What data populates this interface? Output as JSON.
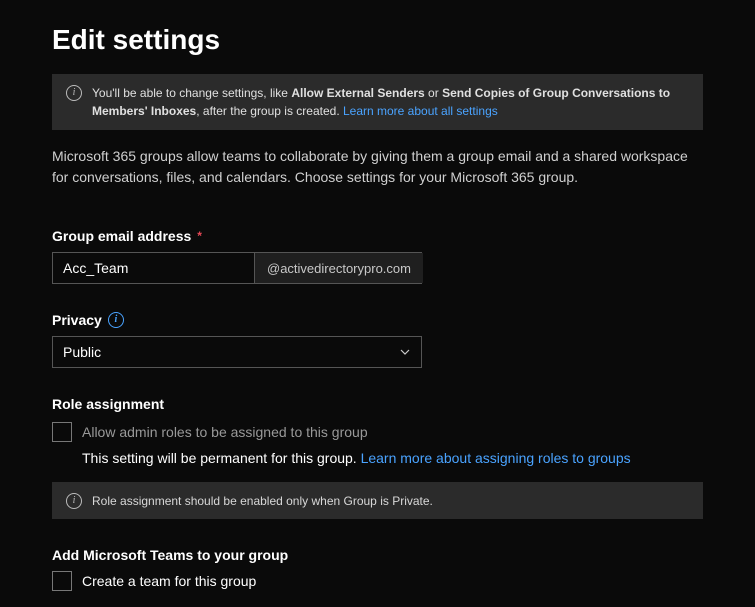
{
  "page": {
    "title": "Edit settings"
  },
  "banner": {
    "prefix": "You'll be able to change settings, like ",
    "bold1": "Allow External Senders",
    "mid": " or ",
    "bold2": "Send Copies of Group Conversations to Members' Inboxes",
    "suffix": ", after the group is created. ",
    "link": "Learn more about all settings"
  },
  "description": "Microsoft 365 groups allow teams to collaborate by giving them a group email and a shared workspace for conversations, files, and calendars. Choose settings for your Microsoft 365 group.",
  "email": {
    "label": "Group email address",
    "value": "Acc_Team",
    "domain": "@activedirectorypro.com"
  },
  "privacy": {
    "label": "Privacy",
    "value": "Public"
  },
  "role": {
    "heading": "Role assignment",
    "checkbox_label": "Allow admin roles to be assigned to this group",
    "note_prefix": "This setting will be permanent for this group. ",
    "note_link": "Learn more about assigning roles to groups",
    "warning": "Role assignment should be enabled only when Group is Private."
  },
  "teams": {
    "heading": "Add Microsoft Teams to your group",
    "checkbox_label": "Create a team for this group"
  }
}
